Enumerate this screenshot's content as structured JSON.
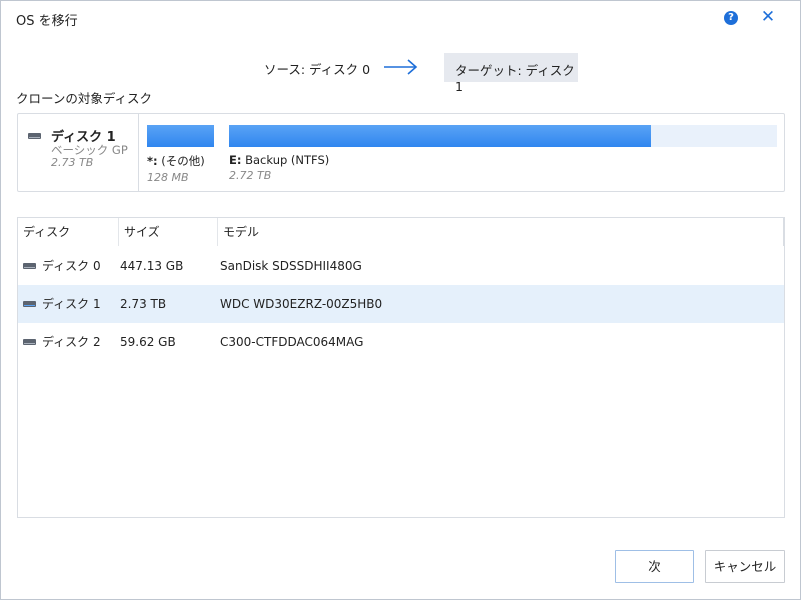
{
  "window": {
    "title": "OS を移行"
  },
  "header": {
    "help_glyph": "?",
    "close_glyph": "✕"
  },
  "route": {
    "source_label": "ソース: ディスク 0",
    "target_label": "ターゲット: ディスク 1"
  },
  "target_section": {
    "title": "クローンの対象ディスク",
    "disk": {
      "name": "ディスク 1",
      "type": "ベーシック GP",
      "size": "2.73 TB"
    },
    "partitions": [
      {
        "letter": "*:",
        "name": "(その他)",
        "size": "128 MB",
        "fill": 1.0
      },
      {
        "letter": "E:",
        "name": "Backup (NTFS)",
        "size": "2.72 TB",
        "fill": 0.77
      }
    ]
  },
  "disk_table": {
    "headers": [
      "ディスク",
      "サイズ",
      "モデル"
    ],
    "rows": [
      {
        "disk": "ディスク 0",
        "size": "447.13 GB",
        "model": "SanDisk SDSSDHII480G",
        "selected": false
      },
      {
        "disk": "ディスク 1",
        "size": "2.73 TB",
        "model": "WDC WD30EZRZ-00Z5HB0",
        "selected": true
      },
      {
        "disk": "ディスク 2",
        "size": "59.62 GB",
        "model": "C300-CTFDDAC064MAG",
        "selected": false
      }
    ]
  },
  "buttons": {
    "next_label": "次",
    "cancel_label": "キャンセル"
  },
  "colors": {
    "accent": "#1e6fd9",
    "bar_fill": "#3b8ef2",
    "selected_row": "#e5f0fb"
  }
}
